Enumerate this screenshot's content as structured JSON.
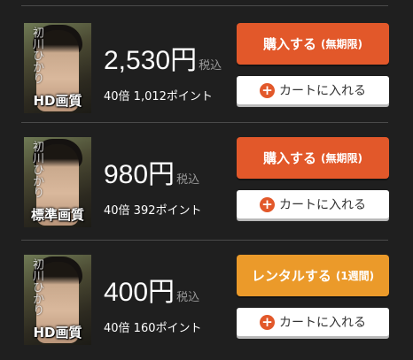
{
  "colors": {
    "background": "#1f1f1f",
    "buy_orange": "#e2582a",
    "rent_orange": "#eb9a2a",
    "cart_white": "#ffffff",
    "plus_icon": "#e2582a",
    "divider": "#4a4a4a"
  },
  "offers": [
    {
      "thumb_title": "初川ひかり",
      "quality": "HD画質",
      "price": "2,530円",
      "tax": "税込",
      "points": "40倍 1,012ポイント",
      "action_label": "購入する",
      "action_sub": "(無期限)",
      "action_type": "purchase",
      "cart_label": "カートに入れる",
      "cart_icon": "plus-circle-icon"
    },
    {
      "thumb_title": "初川ひかり",
      "quality": "標準画質",
      "price": "980円",
      "tax": "税込",
      "points": "40倍 392ポイント",
      "action_label": "購入する",
      "action_sub": "(無期限)",
      "action_type": "purchase",
      "cart_label": "カートに入れる",
      "cart_icon": "plus-circle-icon"
    },
    {
      "thumb_title": "初川ひかり",
      "quality": "HD画質",
      "price": "400円",
      "tax": "税込",
      "points": "40倍 160ポイント",
      "action_label": "レンタルする",
      "action_sub": "(1週間)",
      "action_type": "rental",
      "cart_label": "カートに入れる",
      "cart_icon": "plus-circle-icon"
    }
  ]
}
